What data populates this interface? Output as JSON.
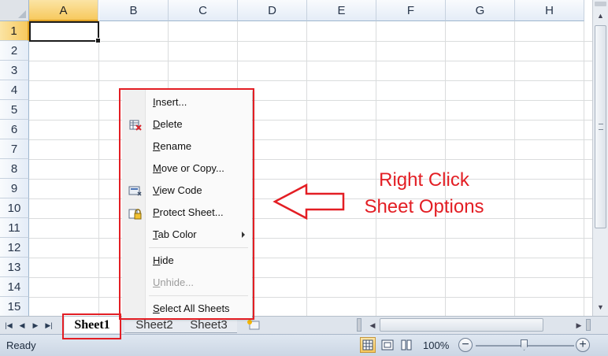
{
  "columns": [
    "A",
    "B",
    "C",
    "D",
    "E",
    "F",
    "G",
    "H"
  ],
  "rows": [
    "1",
    "2",
    "3",
    "4",
    "5",
    "6",
    "7",
    "8",
    "9",
    "10",
    "11",
    "12",
    "13",
    "14",
    "15"
  ],
  "selected_cell": "A1",
  "sheet_tabs": {
    "active": "Sheet1",
    "others": [
      "Sheet2",
      "Sheet3"
    ]
  },
  "context_menu": {
    "items": [
      {
        "label": "Insert...",
        "icon": "",
        "enabled": true
      },
      {
        "label": "Delete",
        "icon": "delete-sheet-icon",
        "enabled": true
      },
      {
        "label": "Rename",
        "icon": "",
        "enabled": true
      },
      {
        "label": "Move or Copy...",
        "icon": "",
        "enabled": true
      },
      {
        "label": "View Code",
        "icon": "view-code-icon",
        "enabled": true
      },
      {
        "label": "Protect Sheet...",
        "icon": "protect-sheet-icon",
        "enabled": true
      },
      {
        "label": "Tab Color",
        "icon": "",
        "enabled": true,
        "submenu": true
      },
      {
        "label": "Hide",
        "icon": "",
        "enabled": true
      },
      {
        "label": "Unhide...",
        "icon": "",
        "enabled": false
      },
      {
        "label": "Select All Sheets",
        "icon": "",
        "enabled": true
      }
    ]
  },
  "status_bar": {
    "status": "Ready",
    "zoom": "100%"
  },
  "annotation": {
    "line1": "Right Click",
    "line2": "Sheet Options",
    "color": "#e31e24"
  }
}
